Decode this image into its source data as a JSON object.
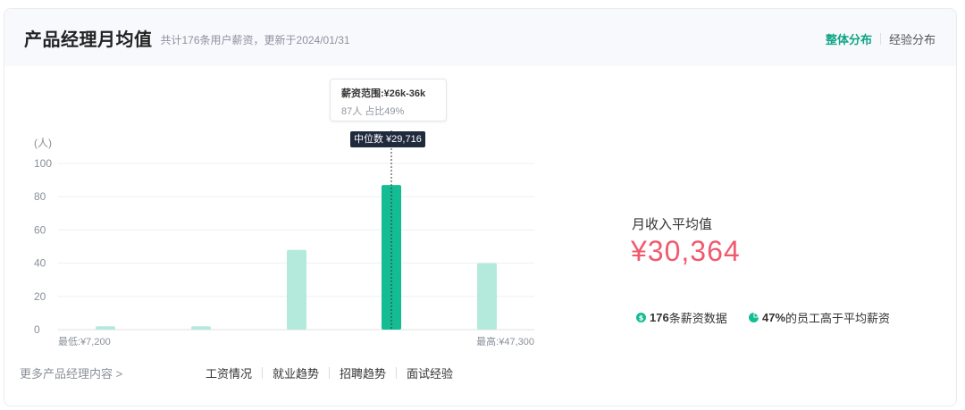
{
  "header": {
    "title": "产品经理月均值",
    "subtitle": "共计176条用户薪资，更新于2024/01/31",
    "tabs": [
      {
        "label": "整体分布",
        "active": true
      },
      {
        "label": "经验分布",
        "active": false
      }
    ]
  },
  "tooltip": {
    "line1": "薪资范围:¥26k-36k",
    "line2": "87人  占比49%"
  },
  "median_tag": "中位数 ¥29,716",
  "average": {
    "label": "月收入平均值",
    "value": "¥30,364"
  },
  "stats": {
    "count_value": "176",
    "count_text": "条薪资数据",
    "pct_value": "47%",
    "pct_text": "的员工高于平均薪资"
  },
  "footer": {
    "more_label": "更多产品经理内容 >",
    "links": [
      "工资情况",
      "就业趋势",
      "招聘趋势",
      "面试经验"
    ]
  },
  "colors": {
    "accent": "#0fa584",
    "bar_highlight": "#14bc94",
    "bar_light": "#b3eadc",
    "average_value": "#f05a6e"
  },
  "chart_data": {
    "type": "bar",
    "unit_label": "(人)",
    "ylim": [
      0,
      100
    ],
    "yticks": [
      0,
      20,
      40,
      60,
      80,
      100
    ],
    "values": [
      2,
      2,
      48,
      87,
      40
    ],
    "highlight_index": 3,
    "min_label": "最低:¥7,200",
    "max_label": "最高:¥47,300",
    "grid": true
  }
}
